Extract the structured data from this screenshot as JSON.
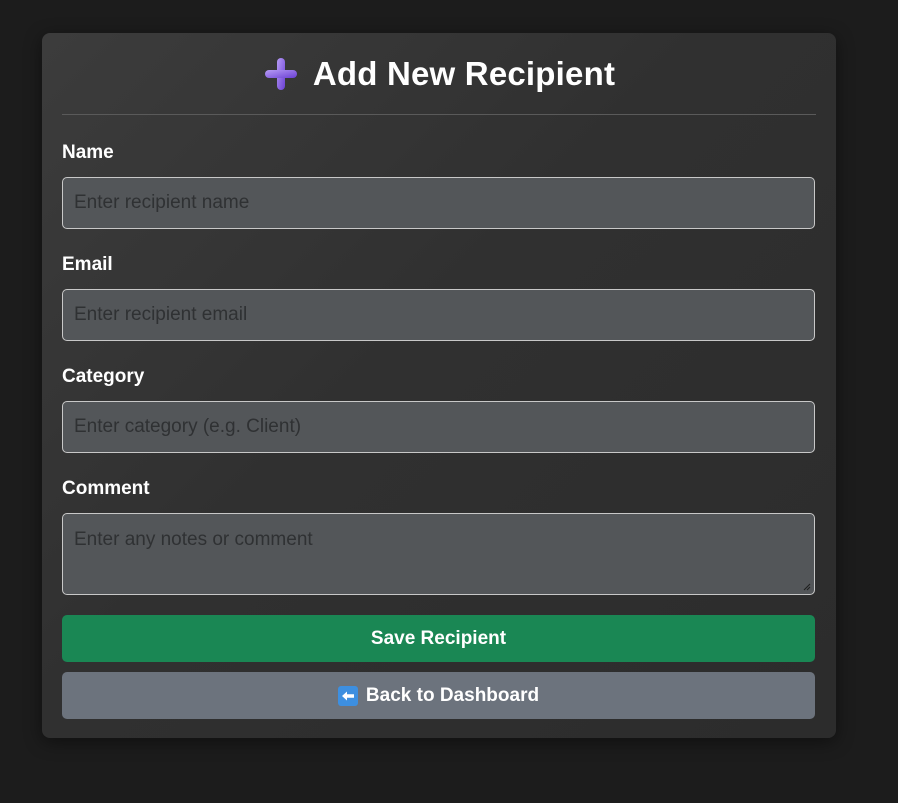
{
  "form": {
    "title": "Add New Recipient",
    "title_icon": "plus-icon",
    "accent_color": "#1a8754",
    "fields": {
      "name": {
        "label": "Name",
        "placeholder": "Enter recipient name",
        "value": ""
      },
      "email": {
        "label": "Email",
        "placeholder": "Enter recipient email",
        "value": ""
      },
      "category": {
        "label": "Category",
        "placeholder": "Enter category (e.g. Client)",
        "value": ""
      },
      "comment": {
        "label": "Comment",
        "placeholder": "Enter any notes or comment",
        "value": ""
      }
    },
    "save_label": "Save Recipient",
    "back_label": "Back to Dashboard",
    "back_icon": "left-arrow-icon"
  }
}
